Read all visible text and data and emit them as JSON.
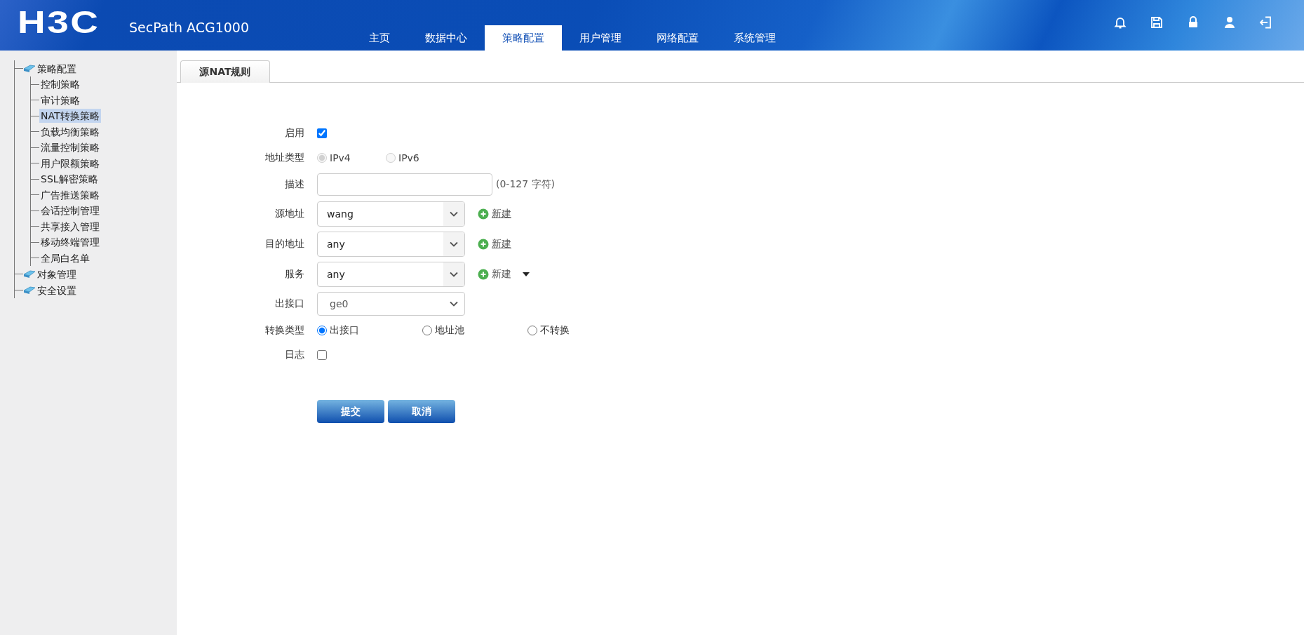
{
  "header": {
    "logo": "H3C",
    "product": "SecPath ACG1000",
    "nav": [
      {
        "label": "主页",
        "selected": false
      },
      {
        "label": "数据中心",
        "selected": false
      },
      {
        "label": "策略配置",
        "selected": true
      },
      {
        "label": "用户管理",
        "selected": false
      },
      {
        "label": "网络配置",
        "selected": false
      },
      {
        "label": "系统管理",
        "selected": false
      }
    ]
  },
  "sidebar": {
    "tree": [
      {
        "label": "策略配置",
        "children": [
          {
            "label": "控制策略",
            "selected": false
          },
          {
            "label": "审计策略",
            "selected": false
          },
          {
            "label": "NAT转换策略",
            "selected": true
          },
          {
            "label": "负载均衡策略",
            "selected": false
          },
          {
            "label": "流量控制策略",
            "selected": false
          },
          {
            "label": "用户限额策略",
            "selected": false
          },
          {
            "label": "SSL解密策略",
            "selected": false
          },
          {
            "label": "广告推送策略",
            "selected": false
          },
          {
            "label": "会话控制管理",
            "selected": false
          },
          {
            "label": "共享接入管理",
            "selected": false
          },
          {
            "label": "移动终端管理",
            "selected": false
          },
          {
            "label": "全局白名单",
            "selected": false
          }
        ]
      },
      {
        "label": "对象管理"
      },
      {
        "label": "安全设置"
      }
    ]
  },
  "tabs": [
    {
      "label": "源NAT规则",
      "selected": true
    }
  ],
  "form": {
    "fields": [
      {
        "kind": "checkbox",
        "label": "启用",
        "checked": true
      },
      {
        "kind": "radio",
        "label": "地址类型",
        "disabled": true,
        "options": [
          {
            "label": "IPv4",
            "selected": true
          },
          {
            "label": "IPv6",
            "selected": false
          }
        ]
      },
      {
        "kind": "text",
        "label": "描述",
        "hint": "(0-127 字符)"
      },
      {
        "kind": "select",
        "label": "源地址",
        "value": "wang",
        "action": {
          "kind": "link",
          "label": "新建"
        }
      },
      {
        "kind": "select",
        "label": "目的地址",
        "value": "any",
        "action": {
          "kind": "link",
          "label": "新建"
        }
      },
      {
        "kind": "select",
        "label": "服务",
        "value": "any",
        "action": {
          "kind": "menu",
          "label": "新建"
        }
      },
      {
        "kind": "combo",
        "label": "出接口",
        "value": "ge0"
      },
      {
        "kind": "radio",
        "label": "转换类型",
        "disabled": false,
        "options": [
          {
            "label": "出接口",
            "selected": true
          },
          {
            "label": "地址池",
            "selected": false
          },
          {
            "label": "不转换",
            "selected": false
          }
        ]
      },
      {
        "kind": "checkbox",
        "label": "日志",
        "checked": false
      }
    ],
    "buttons": [
      "提交",
      "取消"
    ]
  }
}
